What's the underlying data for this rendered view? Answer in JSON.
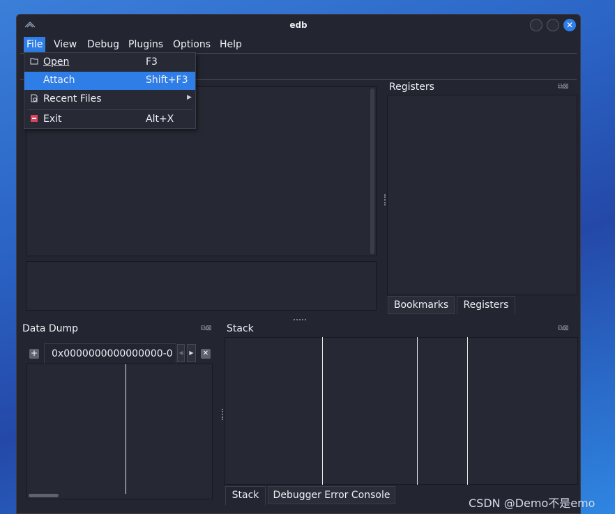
{
  "window": {
    "title": "edb"
  },
  "menubar": {
    "items": [
      "File",
      "View",
      "Debug",
      "Plugins",
      "Options",
      "Help"
    ],
    "active": "File"
  },
  "file_menu": {
    "items": [
      {
        "label": "Open",
        "shortcut": "F3",
        "icon": "folder-open-icon"
      },
      {
        "label": "Attach",
        "shortcut": "Shift+F3",
        "icon": ""
      },
      {
        "label": "Recent Files",
        "shortcut": "",
        "icon": "recent-files-icon",
        "submenu": true
      },
      {
        "label": "Exit",
        "shortcut": "Alt+X",
        "icon": "exit-icon"
      }
    ],
    "highlighted": "Attach"
  },
  "registers": {
    "title": "Registers",
    "tabs": [
      "Bookmarks",
      "Registers"
    ],
    "selected_tab": "Registers"
  },
  "data_dump": {
    "title": "Data Dump",
    "tab_label": "0x0000000000000000-0"
  },
  "stack": {
    "title": "Stack",
    "tabs": [
      "Stack",
      "Debugger Error Console"
    ],
    "selected_tab": "Stack"
  },
  "watermark": "CSDN @Demo不是emo",
  "colors": {
    "accent": "#2f7ee8",
    "window_bg": "#232530",
    "panel_bg": "#262833"
  }
}
